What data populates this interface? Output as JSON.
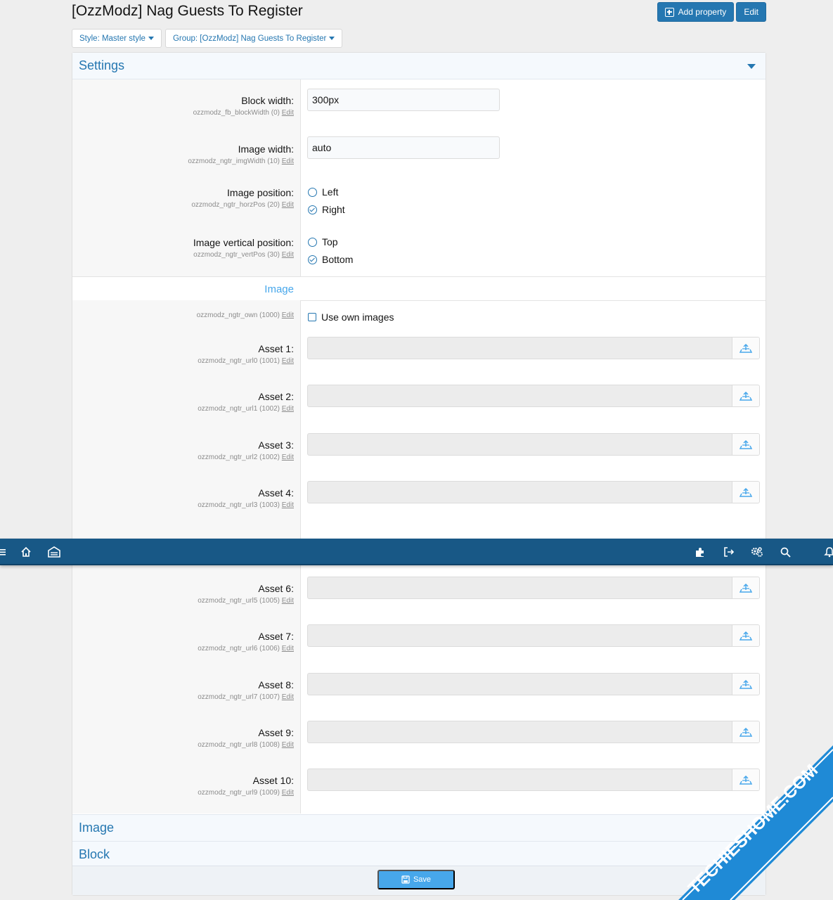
{
  "page": {
    "title": "[OzzModz] Nag Guests To Register",
    "add_property_label": "Add property",
    "edit_label": "Edit"
  },
  "filters": {
    "style": "Style: Master style",
    "group": "Group: [OzzModz] Nag Guests To Register"
  },
  "settings": {
    "header": "Settings",
    "block_width": {
      "label": "Block width:",
      "hint": "ozzmodz_fb_blockWidth (0)",
      "edit": "Edit",
      "value": "300px"
    },
    "image_width": {
      "label": "Image width:",
      "hint": "ozzmodz_ngtr_imgWidth (10)",
      "edit": "Edit",
      "value": "auto"
    },
    "image_position": {
      "label": "Image position:",
      "hint": "ozzmodz_ngtr_horzPos (20)",
      "edit": "Edit",
      "options": [
        "Left",
        "Right"
      ],
      "selected": "Right"
    },
    "image_vertical_position": {
      "label": "Image vertical position:",
      "hint": "ozzmodz_ngtr_vertPos (30)",
      "edit": "Edit",
      "options": [
        "Top",
        "Bottom"
      ],
      "selected": "Bottom"
    }
  },
  "image_section": {
    "heading": "Image",
    "own_images": {
      "hint": "ozzmodz_ngtr_own (1000)",
      "edit": "Edit",
      "label": "Use own images",
      "checked": false
    },
    "assets_top": [
      {
        "label": "Asset 1:",
        "hint": "ozzmodz_ngtr_url0 (1001)",
        "edit": "Edit"
      },
      {
        "label": "Asset 2:",
        "hint": "ozzmodz_ngtr_url1 (1002)",
        "edit": "Edit"
      },
      {
        "label": "Asset 3:",
        "hint": "ozzmodz_ngtr_url2 (1002)",
        "edit": "Edit"
      },
      {
        "label": "Asset 4:",
        "hint": "ozzmodz_ngtr_url3 (1003)",
        "edit": "Edit"
      }
    ],
    "assets_bottom": [
      {
        "label": "Asset 6:",
        "hint": "ozzmodz_ngtr_url5 (1005)",
        "edit": "Edit"
      },
      {
        "label": "Asset 7:",
        "hint": "ozzmodz_ngtr_url6 (1006)",
        "edit": "Edit"
      },
      {
        "label": "Asset 8:",
        "hint": "ozzmodz_ngtr_url7 (1007)",
        "edit": "Edit"
      },
      {
        "label": "Asset 9:",
        "hint": "ozzmodz_ngtr_url8 (1008)",
        "edit": "Edit"
      },
      {
        "label": "Asset 10:",
        "hint": "ozzmodz_ngtr_url9 (1009)",
        "edit": "Edit"
      }
    ]
  },
  "collapsed_sections": [
    "Image",
    "Block"
  ],
  "footer": {
    "save_label": "Save"
  },
  "navbar": {
    "left_icons": [
      "menu-icon",
      "home-icon",
      "warehouse-icon"
    ],
    "right_icons": [
      "puzzle-icon",
      "logout-icon",
      "settings-icon",
      "search-icon",
      "bell-icon"
    ]
  },
  "watermark": "TECHIESHOME.COM",
  "colors": {
    "accent": "#2577b1",
    "navbar": "#185886",
    "save_button": "#47a7eb",
    "watermark": "#1f8ad6"
  }
}
